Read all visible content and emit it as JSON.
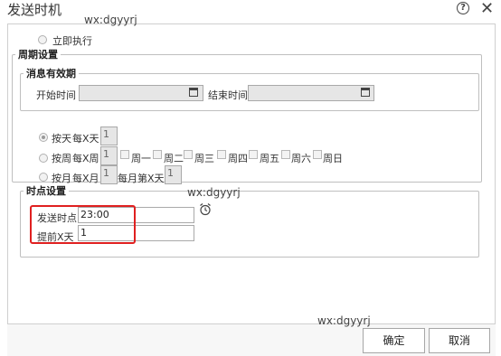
{
  "window": {
    "title": "发送时机"
  },
  "watermark": "wx:dgyyrj",
  "immediate": {
    "label": "立即执行"
  },
  "cycle": {
    "legend": "周期设置",
    "validity": {
      "legend": "消息有效期",
      "start_label": "开始时间",
      "end_label": "结束时间",
      "start_value": "",
      "end_value": ""
    },
    "by_day": {
      "label": "按天",
      "every_label": "每X天",
      "value": "1"
    },
    "by_week": {
      "label": "按周",
      "every_label": "每X周",
      "value": "1",
      "days": [
        "周一",
        "周二",
        "周三",
        "周四",
        "周五",
        "周六",
        "周日"
      ]
    },
    "by_month": {
      "label": "按月",
      "every_label": "每X月",
      "value": "1",
      "day_label": "每月第X天",
      "day_value": "1"
    }
  },
  "time_point": {
    "legend": "时点设置",
    "send_time_label": "发送时点",
    "send_time_value": "23:00",
    "advance_label": "提前X天",
    "advance_value": "1"
  },
  "buttons": {
    "ok": "确定",
    "cancel": "取消"
  },
  "colors": {
    "highlight": "#e02020"
  }
}
